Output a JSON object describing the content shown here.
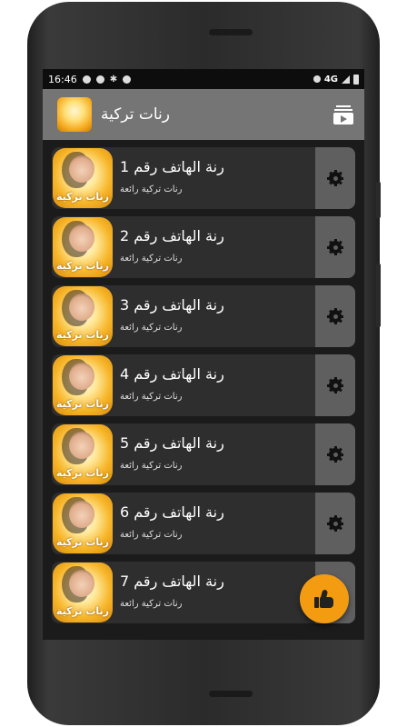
{
  "status_bar": {
    "time": "16:46",
    "network": "4G"
  },
  "app_bar": {
    "logo_icon": "app-logo-icon",
    "title": "رنات تركية",
    "playlist_icon": "playlist-play-icon"
  },
  "ringtones": [
    {
      "title": "رنة الهاتف رقم 1",
      "subtitle": "رنات تركية رائعة",
      "thumb_text": "رنات تركية"
    },
    {
      "title": "رنة الهاتف رقم 2",
      "subtitle": "رنات تركية رائعة",
      "thumb_text": "رنات تركية"
    },
    {
      "title": "رنة الهاتف رقم 3",
      "subtitle": "رنات تركية رائعة",
      "thumb_text": "رنات تركية"
    },
    {
      "title": "رنة الهاتف رقم 4",
      "subtitle": "رنات تركية رائعة",
      "thumb_text": "رنات تركية"
    },
    {
      "title": "رنة الهاتف رقم 5",
      "subtitle": "رنات تركية رائعة",
      "thumb_text": "رنات تركية"
    },
    {
      "title": "رنة الهاتف رقم 6",
      "subtitle": "رنات تركية رائعة",
      "thumb_text": "رنات تركية"
    },
    {
      "title": "رنة الهاتف رقم 7",
      "subtitle": "رنات تركية رائعة",
      "thumb_text": "رنات تركية"
    }
  ],
  "fab": {
    "icon": "thumbs-up-icon"
  },
  "colors": {
    "app_bar": "#757575",
    "background": "#1b1b1b",
    "card": "#2e2e2e",
    "action_panel": "#5f5f5f",
    "fab": "#f39c12"
  }
}
